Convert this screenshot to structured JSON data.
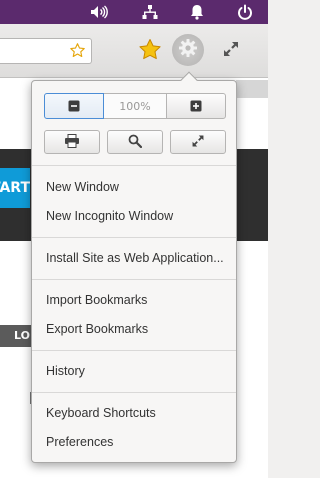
{
  "system_panel": {
    "icons": [
      "volume-icon",
      "network-icon",
      "notification-bell-icon",
      "power-icon"
    ]
  },
  "toolbar": {
    "icons": [
      "bookmark-star-icon",
      "star-icon",
      "gear-icon",
      "fullscreen-icon"
    ]
  },
  "background_page": {
    "start_fragment": "TART",
    "lo_fragment": "LO"
  },
  "menu": {
    "zoom": {
      "level": "100%",
      "icons": [
        "zoom-out-icon",
        "zoom-in-icon"
      ]
    },
    "tools": {
      "icons": [
        "print-icon",
        "find-icon",
        "fullscreen-icon"
      ]
    },
    "items": [
      {
        "label": "New Window"
      },
      {
        "label": "New Incognito Window"
      },
      {
        "label": "Install Site as Web Application..."
      },
      {
        "label": "Import Bookmarks"
      },
      {
        "label": "Export Bookmarks"
      },
      {
        "label": "History"
      },
      {
        "label": "Keyboard Shortcuts"
      },
      {
        "label": "Preferences"
      }
    ]
  }
}
